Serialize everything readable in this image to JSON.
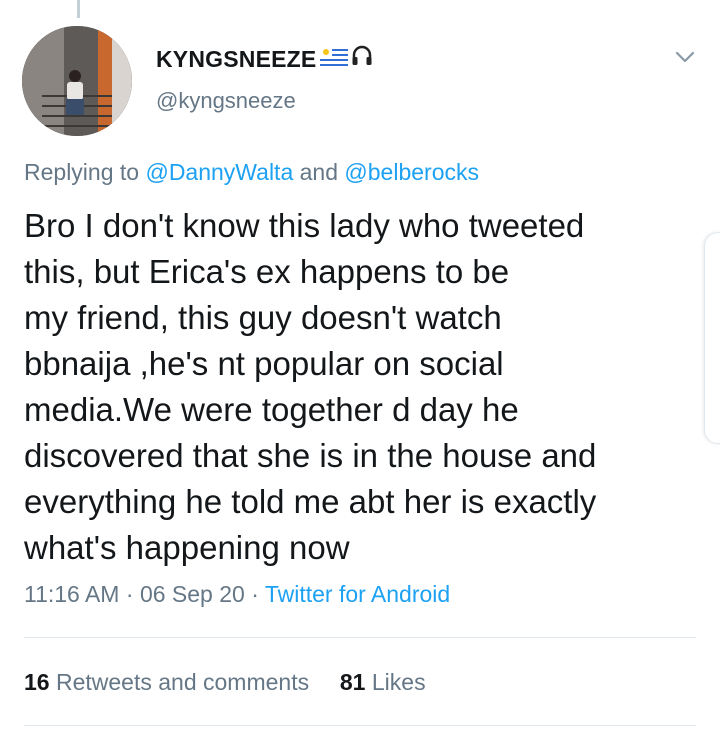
{
  "tweet": {
    "display_name": "KYNGSNEEZE",
    "name_emojis": [
      "flag-icon",
      "headphones-icon"
    ],
    "handle": "@kyngsneeze",
    "replying_prefix": "Replying to ",
    "replying_users": [
      "@DannyWalta",
      "@belberocks"
    ],
    "replying_joiner": " and ",
    "text": "Bro I don't know this lady who tweeted\nthis,  but Erica's  ex happens to be\nmy friend, this guy doesn't watch\nbbnaija ,he's nt popular on social\nmedia.We were together d day he\ndiscovered that she is in the house and\neverything he told me abt her is exactly\nwhat's happening now",
    "time": "11:16 AM",
    "date": "06 Sep 20",
    "separator": " · ",
    "source": "Twitter for Android",
    "retweets_count": "16",
    "retweets_label": " Retweets and comments",
    "likes_count": "81",
    "likes_label": " Likes"
  },
  "colors": {
    "link": "#1da1f2",
    "secondary_text": "#657786",
    "primary_text": "#14171a"
  }
}
